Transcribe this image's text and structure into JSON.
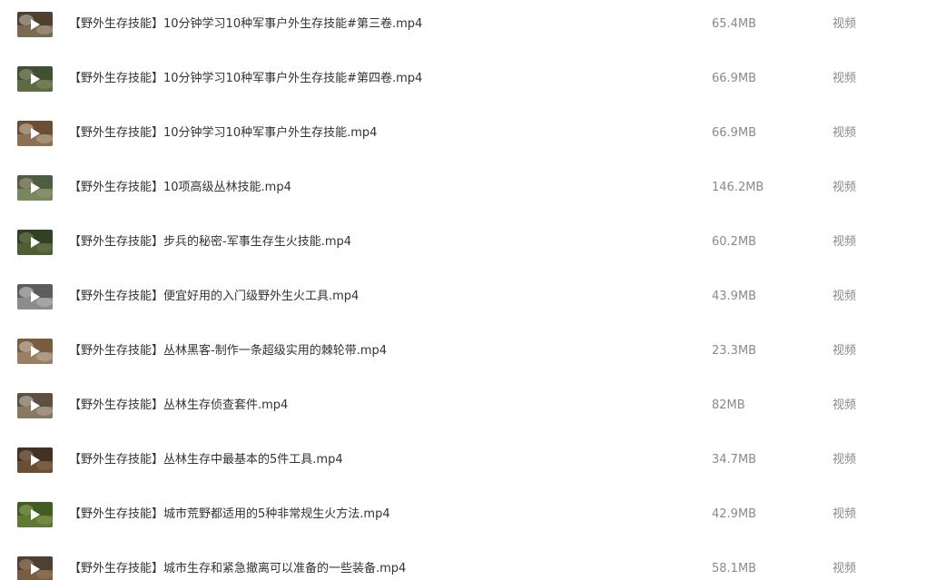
{
  "files": [
    {
      "name": "【野外生存技能】10分钟学习10种军事户外生存技能#第三卷.mp4",
      "size": "65.4MB",
      "type": "视频",
      "thumb_colors": [
        "#5a4a3a",
        "#8a7a5a",
        "#c9c2b0"
      ]
    },
    {
      "name": "【野外生存技能】10分钟学习10种军事户外生存技能#第四卷.mp4",
      "size": "66.9MB",
      "type": "视频",
      "thumb_colors": [
        "#4a5a3a",
        "#6a7a4a",
        "#9aa27a"
      ]
    },
    {
      "name": "【野外生存技能】10分钟学习10种军事户外生存技能.mp4",
      "size": "66.9MB",
      "type": "视频",
      "thumb_colors": [
        "#7a5a3a",
        "#a08060",
        "#d8c8b0"
      ]
    },
    {
      "name": "【野外生存技能】10项高级丛林技能.mp4",
      "size": "146.2MB",
      "type": "视频",
      "thumb_colors": [
        "#5a6a4a",
        "#8a9a6a",
        "#b0a890"
      ]
    },
    {
      "name": "【野外生存技能】步兵的秘密-军事生存生火技能.mp4",
      "size": "60.2MB",
      "type": "视频",
      "thumb_colors": [
        "#3a4a2a",
        "#5a6a3a",
        "#7a8a5a"
      ]
    },
    {
      "name": "【野外生存技能】便宜好用的入门级野外生火工具.mp4",
      "size": "43.9MB",
      "type": "视频",
      "thumb_colors": [
        "#6a6a6a",
        "#a0a0a0",
        "#d8d8d8"
      ]
    },
    {
      "name": "【野外生存技能】丛林黑客-制作一条超级实用的棘轮带.mp4",
      "size": "23.3MB",
      "type": "视频",
      "thumb_colors": [
        "#8a6a4a",
        "#b09070",
        "#e0d0c0"
      ]
    },
    {
      "name": "【野外生存技能】丛林生存侦查套件.mp4",
      "size": "82MB",
      "type": "视频",
      "thumb_colors": [
        "#6a5a4a",
        "#9a8a70",
        "#d0c8b8"
      ]
    },
    {
      "name": "【野外生存技能】丛林生存中最基本的5件工具.mp4",
      "size": "34.7MB",
      "type": "视频",
      "thumb_colors": [
        "#4a3a2a",
        "#7a5a3a",
        "#a08060"
      ]
    },
    {
      "name": "【野外生存技能】城市荒野都适用的5种非常规生火方法.mp4",
      "size": "42.9MB",
      "type": "视频",
      "thumb_colors": [
        "#4a6a2a",
        "#6a8a3a",
        "#9ab060"
      ]
    },
    {
      "name": "【野外生存技能】城市生存和紧急撤离可以准备的一些装备.mp4",
      "size": "58.1MB",
      "type": "视频",
      "thumb_colors": [
        "#5a4a3a",
        "#8a6a4a",
        "#b09070"
      ]
    }
  ],
  "icons": {
    "thumbnail_overlay": "play-icon"
  }
}
